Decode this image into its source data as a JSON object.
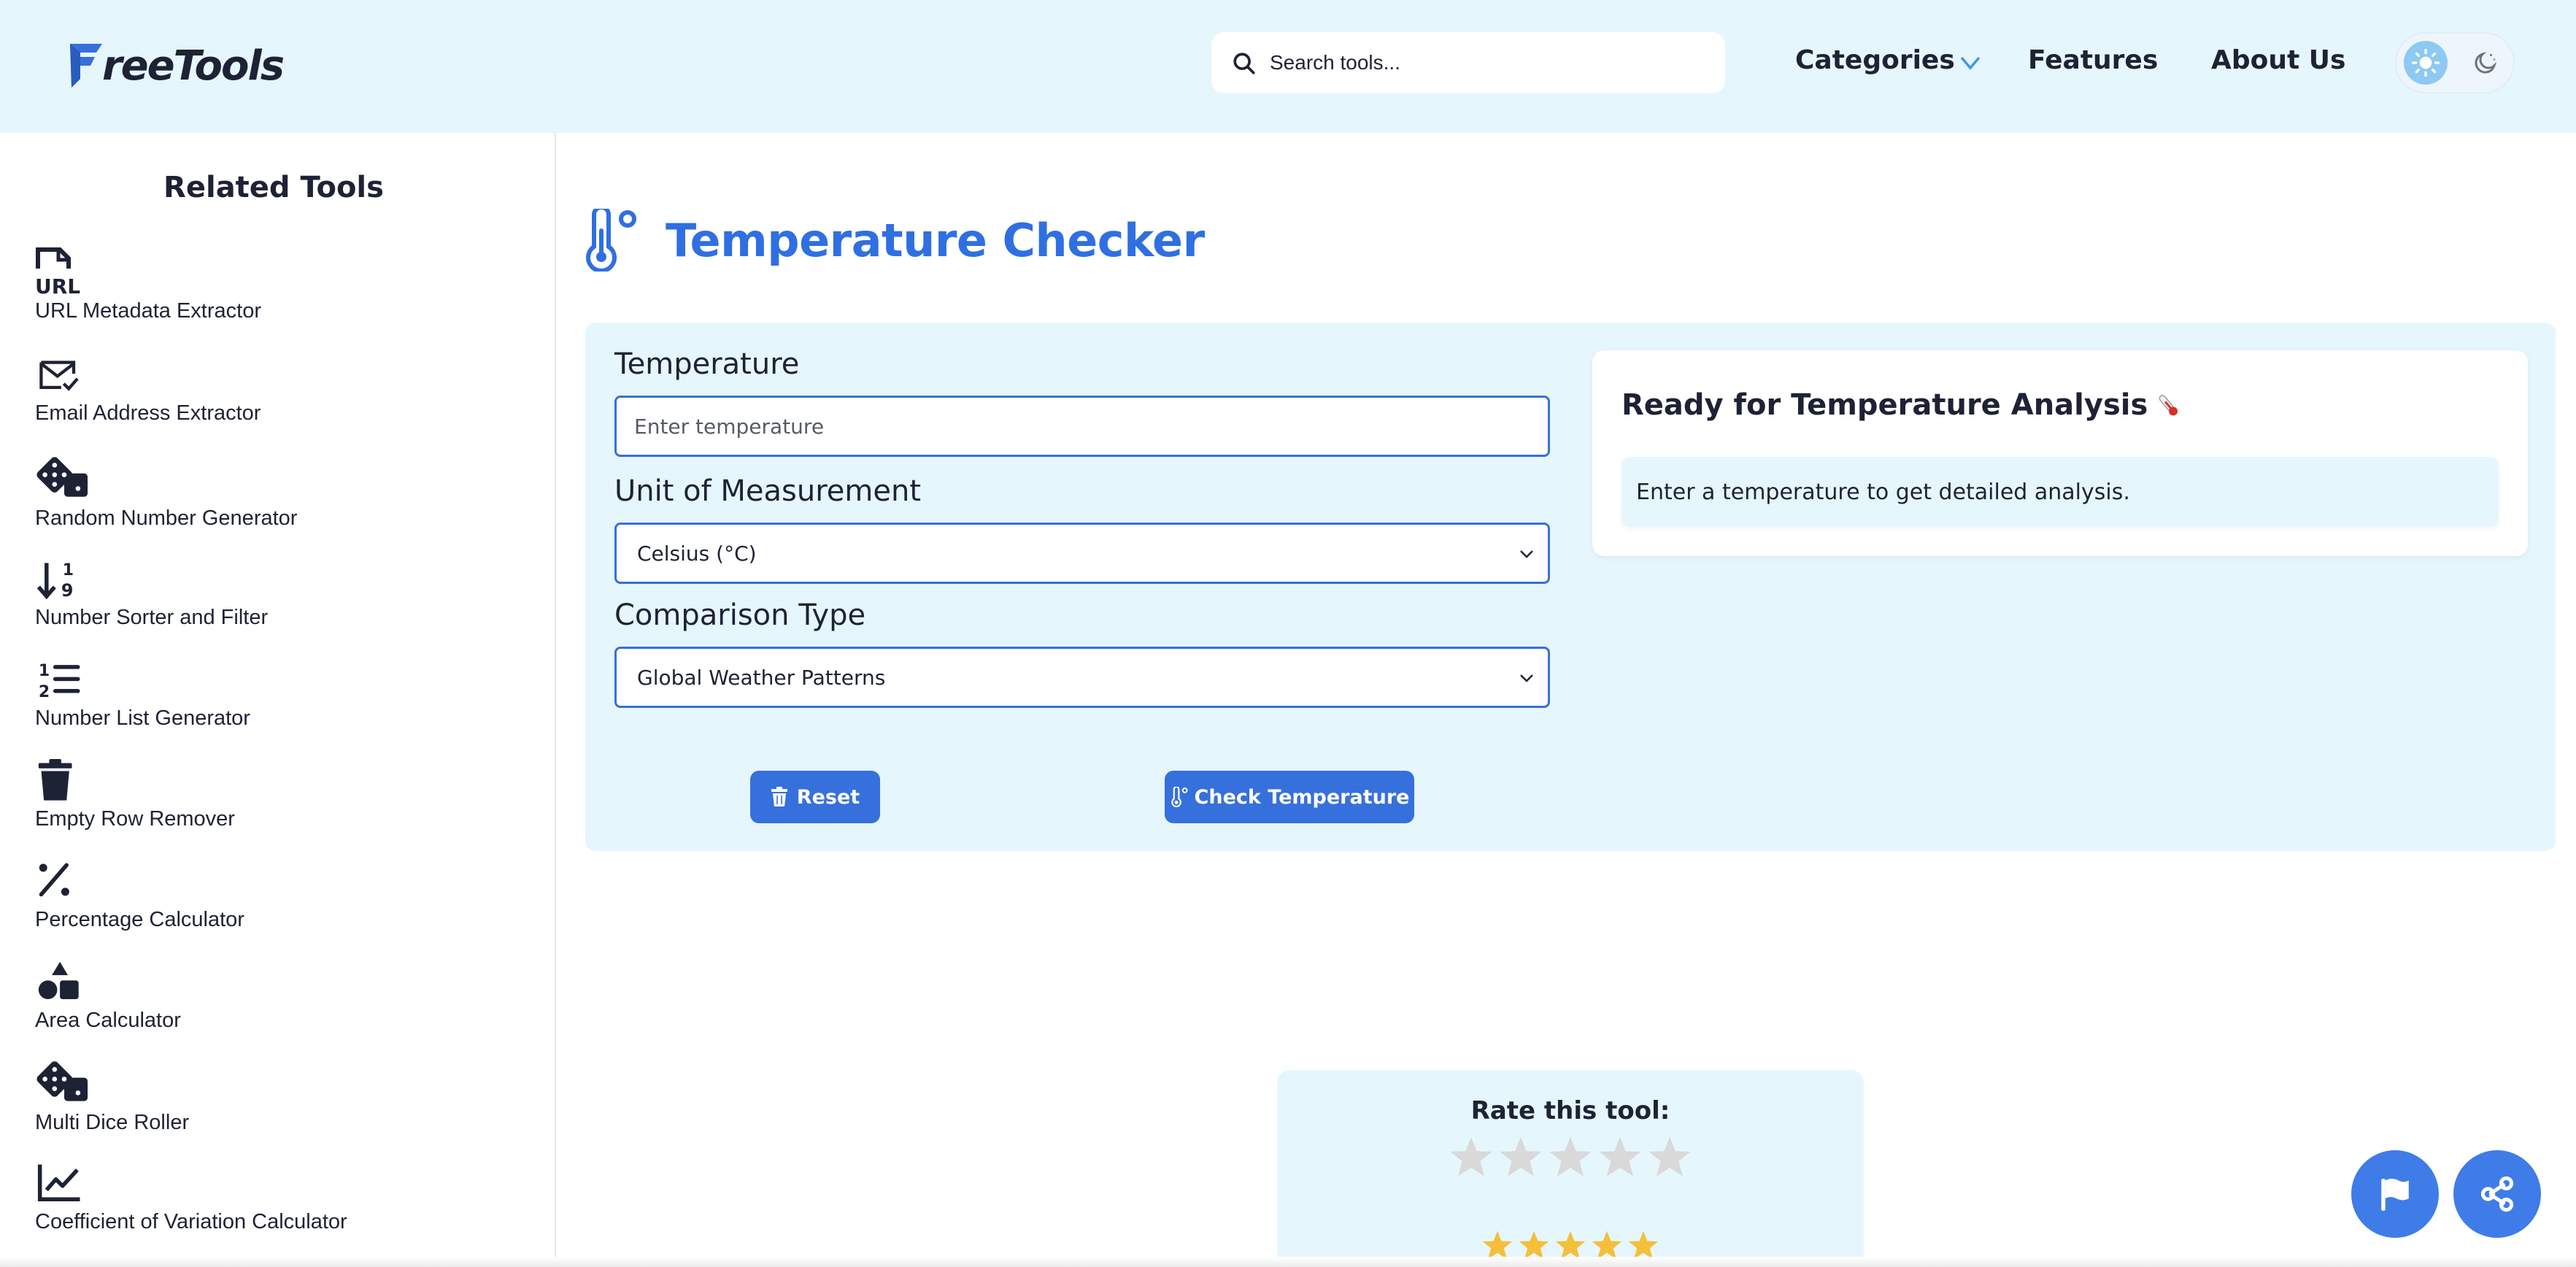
{
  "header": {
    "logo_text": "reeTools",
    "search_placeholder": "Search tools...",
    "nav": {
      "categories": "Categories",
      "features": "Features",
      "about": "About Us"
    }
  },
  "sidebar": {
    "title": "Related Tools",
    "items": [
      {
        "label": "URL Metadata Extractor",
        "icon": "url-file-icon"
      },
      {
        "label": "Email Address Extractor",
        "icon": "envelope-check-icon"
      },
      {
        "label": "Random Number Generator",
        "icon": "dice-icon"
      },
      {
        "label": "Number Sorter and Filter",
        "icon": "sort-numeric-icon"
      },
      {
        "label": "Number List Generator",
        "icon": "numbered-list-icon"
      },
      {
        "label": "Empty Row Remover",
        "icon": "trash-icon"
      },
      {
        "label": "Percentage Calculator",
        "icon": "percent-icon"
      },
      {
        "label": "Area Calculator",
        "icon": "shapes-icon"
      },
      {
        "label": "Multi Dice Roller",
        "icon": "dice-icon"
      },
      {
        "label": "Coefficient of Variation Calculator",
        "icon": "chart-line-icon"
      }
    ]
  },
  "main": {
    "title": "Temperature Checker",
    "temperature_label": "Temperature",
    "temperature_placeholder": "Enter temperature",
    "temperature_value": "",
    "unit_label": "Unit of Measurement",
    "unit_selected": "Celsius (°C)",
    "comparison_label": "Comparison Type",
    "comparison_selected": "Global Weather Patterns",
    "reset_label": "Reset",
    "check_label": "Check Temperature",
    "result_title": "Ready for Temperature Analysis",
    "result_text": "Enter a temperature to get detailed analysis."
  },
  "rating": {
    "title": "Rate this tool:",
    "max_stars": 5,
    "current_rating": 5
  },
  "colors": {
    "accent": "#3670dd",
    "title_blue": "#2f6fe2",
    "header_bg": "#e6f6fd",
    "star_gold": "#f4bf3a",
    "star_grey": "#d9d9d9"
  }
}
